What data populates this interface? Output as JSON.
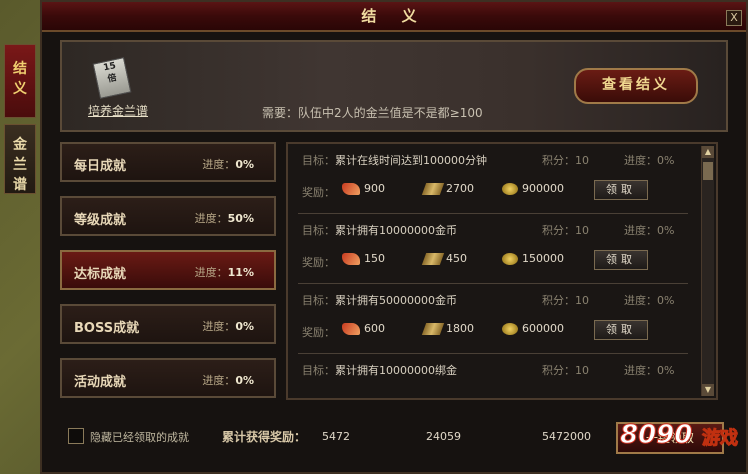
{
  "window": {
    "title": "结 义",
    "close_label": "X"
  },
  "side_tabs": [
    {
      "label": "结\n义",
      "active": true
    },
    {
      "label": "金\n兰\n谱",
      "active": false
    }
  ],
  "banner": {
    "book_label": "培养金兰谱",
    "book_icon_text": "15\n倍",
    "requirement": "需要：队伍中2人的金兰值是不是都≥100",
    "view_button": "查看结义"
  },
  "categories": [
    {
      "name": "每日成就",
      "progress_label": "进度：",
      "progress": "0%",
      "active": false
    },
    {
      "name": "等级成就",
      "progress_label": "进度：",
      "progress": "50%",
      "active": false
    },
    {
      "name": "达标成就",
      "progress_label": "进度：",
      "progress": "11%",
      "active": true
    },
    {
      "name": "BOSS成就",
      "progress_label": "进度：",
      "progress": "0%",
      "active": false
    },
    {
      "name": "活动成就",
      "progress_label": "进度：",
      "progress": "0%",
      "active": false
    }
  ],
  "achievements": [
    {
      "goal_label": "目标：",
      "goal": "累计在线时间达到100000分钟",
      "score": "积分：10",
      "progress": "进度：0%",
      "reward_label": "奖励：",
      "rewards": [
        "900",
        "2700",
        "900000"
      ],
      "claim": "领取"
    },
    {
      "goal_label": "目标：",
      "goal": "累计拥有10000000金币",
      "score": "积分：10",
      "progress": "进度：0%",
      "reward_label": "奖励：",
      "rewards": [
        "150",
        "450",
        "150000"
      ],
      "claim": "领取"
    },
    {
      "goal_label": "目标：",
      "goal": "累计拥有50000000金币",
      "score": "积分：10",
      "progress": "进度：0%",
      "reward_label": "奖励：",
      "rewards": [
        "600",
        "1800",
        "600000"
      ],
      "claim": "领取"
    },
    {
      "goal_label": "目标：",
      "goal": "累计拥有10000000绑金",
      "score": "积分：10",
      "progress": "进度：0%",
      "reward_label": "",
      "rewards": [],
      "claim": ""
    }
  ],
  "footer": {
    "hide_claimed": "隐藏已经领取的成就",
    "total_label": "累计获得奖励：",
    "totals": [
      "5472",
      "24059",
      "5472000"
    ],
    "one_click": "一键领取"
  },
  "logo": {
    "number": "8090",
    "word": "游戏"
  },
  "icons": {
    "reward_1": "wing-icon",
    "reward_2": "scroll-icon",
    "reward_3": "gold-coin-icon"
  }
}
